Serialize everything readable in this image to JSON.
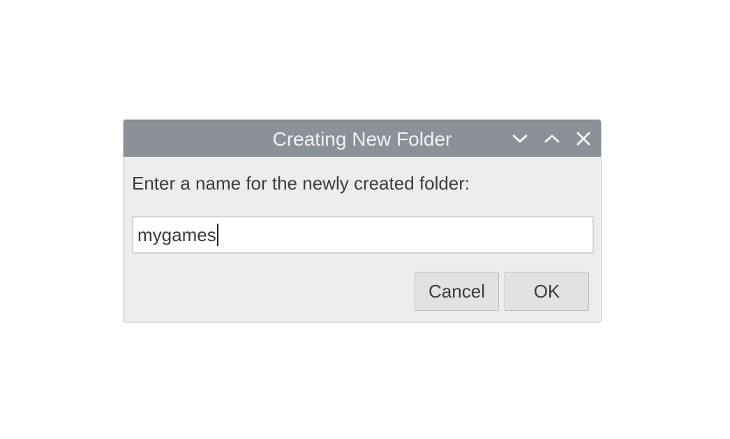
{
  "dialog": {
    "title": "Creating New Folder",
    "prompt": "Enter a name for the newly created folder:",
    "input_value": "mygames",
    "cancel_label": "Cancel",
    "ok_label": "OK",
    "titlebar_buttons": {
      "minimize_icon": "chevron-down-icon",
      "maximize_icon": "chevron-up-icon",
      "close_icon": "close-icon"
    }
  },
  "colors": {
    "titlebar": "#8c9198",
    "title_text": "#f1f2f3",
    "dialog_bg": "#ededed",
    "button_bg": "#e2e2e2"
  }
}
